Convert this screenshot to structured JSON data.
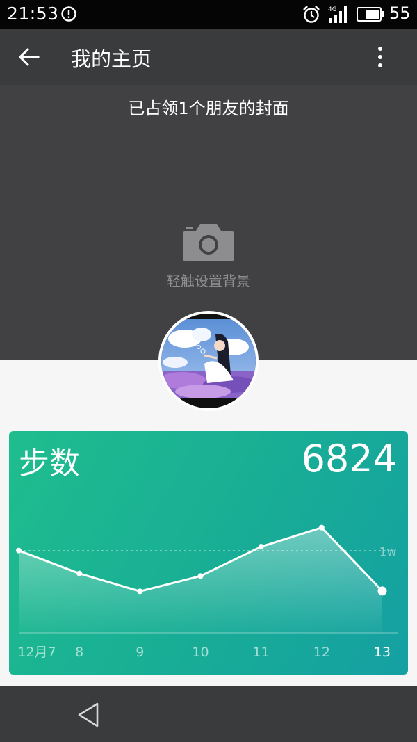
{
  "status_bar": {
    "time": "21:53",
    "network": "4G",
    "battery": "55",
    "icons": [
      "alert-icon",
      "alarm-icon",
      "signal-icon",
      "battery-icon"
    ]
  },
  "app_bar": {
    "title": "我的主页",
    "icons": [
      "back-arrow-icon",
      "more-vert-icon"
    ]
  },
  "cover": {
    "status_text": "已占领1个朋友的封面",
    "set_background_label": "轻触设置背景",
    "icon": "camera-icon"
  },
  "steps_card": {
    "label": "步数",
    "value": "6824",
    "colors": {
      "gradient_start": "#1fbd8e",
      "gradient_end": "#15a0a2"
    }
  },
  "chart_data": {
    "type": "area",
    "title": "步数",
    "categories": [
      "12月7",
      "8",
      "9",
      "10",
      "11",
      "12",
      "13"
    ],
    "series": [
      {
        "values": [
          10000,
          8200,
          6800,
          8000,
          10300,
          11800,
          6824
        ]
      }
    ],
    "reference_lines": [
      {
        "label": "1w",
        "value": 10000
      }
    ],
    "highlighted_point": "13",
    "ylim": [
      3000,
      15000
    ],
    "grid": false
  },
  "nav_bar": {
    "icons": [
      "nav-back-icon"
    ]
  }
}
